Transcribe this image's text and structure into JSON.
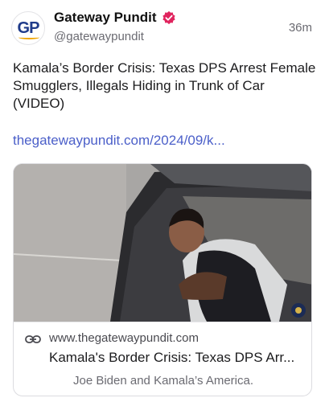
{
  "author": {
    "avatar_text": "GP",
    "name": "Gateway Pundit",
    "handle": "@gatewaypundit",
    "verified_icon": "verified-badge-icon",
    "verified_color": "#e0245e"
  },
  "post": {
    "time": "36m",
    "text": "Kamala’s Border Crisis: Texas DPS Arrest Female Smugglers, Illegals Hiding in Trunk of Car (VIDEO)",
    "link": "thegatewaypundit.com/2024/09/k...",
    "link_color": "#4b5fc9"
  },
  "link_card": {
    "image_icon": "car-trunk-photo",
    "link_icon": "link-icon",
    "domain": "www.thegatewaypundit.com",
    "title": "Kamala's Border Crisis: Texas DPS Arr...",
    "description": "Joe Biden and Kamala’s America."
  }
}
